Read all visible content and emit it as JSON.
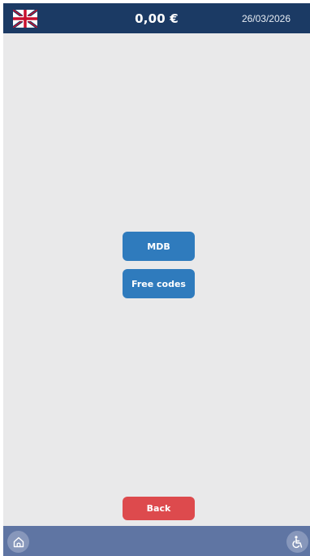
{
  "header": {
    "language_icon": "uk-flag-icon",
    "balance": "0,00 €",
    "date": "26/03/2026"
  },
  "main": {
    "buttons": [
      {
        "label": "MDB"
      },
      {
        "label": "Free codes"
      }
    ],
    "back_label": "Back"
  },
  "footer": {
    "home_icon": "home-icon",
    "accessibility_icon": "wheelchair-icon"
  },
  "colors": {
    "header_bg": "#1b3a64",
    "body_bg": "#e9e9ea",
    "primary_button": "#2f7bbd",
    "back_button": "#dd4a4d",
    "footer_bg": "#5f75a3"
  }
}
